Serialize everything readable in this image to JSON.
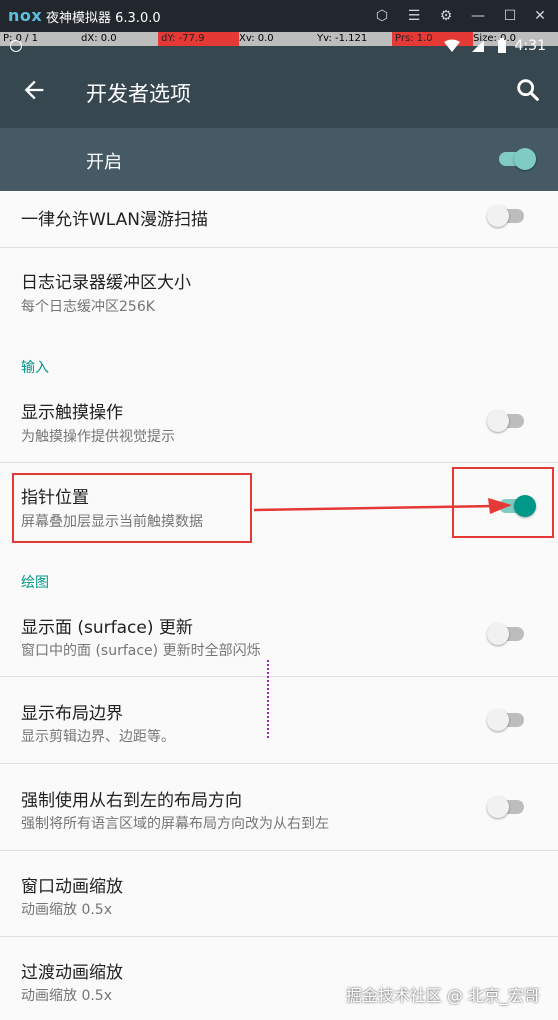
{
  "emulator": {
    "logo": "nox",
    "title": "夜神模拟器 6.3.0.0",
    "debug": {
      "p": "P: 0 / 1",
      "dx": "dX: 0.0",
      "dy": "dY: -77.9",
      "xv": "Xv: 0.0",
      "yv": "Yv: -1.121",
      "prs": "Prs: 1.0",
      "size": "Size: 0.0"
    }
  },
  "status_bar": {
    "time": "4:31"
  },
  "app_bar": {
    "title": "开发者选项"
  },
  "master_switch": {
    "label": "开启",
    "on": true
  },
  "items": [
    {
      "title": "一律允许WLAN漫游扫描",
      "summary": "",
      "on": false
    },
    {
      "title": "日志记录器缓冲区大小",
      "summary": "每个日志缓冲区256K"
    },
    {
      "category": "输入"
    },
    {
      "title": "显示触摸操作",
      "summary": "为触摸操作提供视觉提示",
      "on": false
    },
    {
      "title": "指针位置",
      "summary": "屏幕叠加层显示当前触摸数据",
      "on": true
    },
    {
      "category": "绘图"
    },
    {
      "title": "显示面 (surface) 更新",
      "summary": "窗口中的面 (surface) 更新时全部闪烁",
      "on": false
    },
    {
      "title": "显示布局边界",
      "summary": "显示剪辑边界、边距等。",
      "on": false
    },
    {
      "title": "强制使用从右到左的布局方向",
      "summary": "强制将所有语言区域的屏幕布局方向改为从右到左",
      "on": false
    },
    {
      "title": "窗口动画缩放",
      "summary": "动画缩放 0.5x"
    },
    {
      "title": "过渡动画缩放",
      "summary": "动画缩放 0.5x"
    }
  ],
  "watermark": "掘金技术社区 @ 北京_宏哥",
  "colors": {
    "accent": "#009688",
    "appbar": "#37474f",
    "highlight": "#e53935"
  }
}
